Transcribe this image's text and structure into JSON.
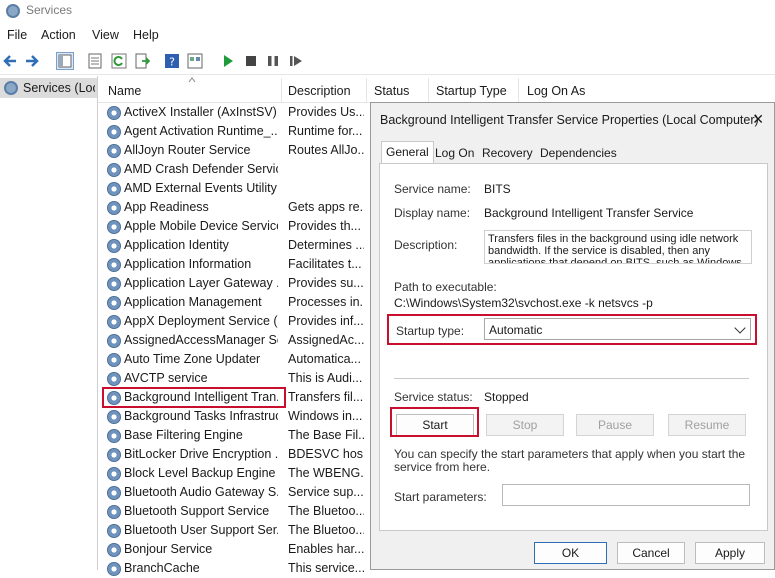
{
  "window": {
    "title": "Services"
  },
  "menu": [
    "File",
    "Action",
    "View",
    "Help"
  ],
  "left_pane": {
    "item": "Services (Local)"
  },
  "list": {
    "columns": [
      "Name",
      "Description",
      "Status",
      "Startup Type",
      "Log On As"
    ],
    "rows": [
      {
        "name": "ActiveX Installer (AxInstSV)",
        "desc": "Provides Us..."
      },
      {
        "name": "Agent Activation Runtime_...",
        "desc": "Runtime for..."
      },
      {
        "name": "AllJoyn Router Service",
        "desc": "Routes AllJo..."
      },
      {
        "name": "AMD Crash Defender Service",
        "desc": ""
      },
      {
        "name": "AMD External Events Utility",
        "desc": ""
      },
      {
        "name": "App Readiness",
        "desc": "Gets apps re..."
      },
      {
        "name": "Apple Mobile Device Service",
        "desc": "Provides th..."
      },
      {
        "name": "Application Identity",
        "desc": "Determines ..."
      },
      {
        "name": "Application Information",
        "desc": "Facilitates t..."
      },
      {
        "name": "Application Layer Gateway ...",
        "desc": "Provides su..."
      },
      {
        "name": "Application Management",
        "desc": "Processes in..."
      },
      {
        "name": "AppX Deployment Service (...",
        "desc": "Provides inf..."
      },
      {
        "name": "AssignedAccessManager Se...",
        "desc": "AssignedAc..."
      },
      {
        "name": "Auto Time Zone Updater",
        "desc": "Automatica..."
      },
      {
        "name": "AVCTP service",
        "desc": "This is Audi..."
      },
      {
        "name": "Background Intelligent Tran...",
        "desc": "Transfers fil..."
      },
      {
        "name": "Background Tasks Infrastruc...",
        "desc": "Windows in..."
      },
      {
        "name": "Base Filtering Engine",
        "desc": "The Base Fil..."
      },
      {
        "name": "BitLocker Drive Encryption ...",
        "desc": "BDESVC hos..."
      },
      {
        "name": "Block Level Backup Engine ...",
        "desc": "The WBENG..."
      },
      {
        "name": "Bluetooth Audio Gateway S...",
        "desc": "Service sup..."
      },
      {
        "name": "Bluetooth Support Service",
        "desc": "The Bluetoo..."
      },
      {
        "name": "Bluetooth User Support Ser...",
        "desc": "The Bluetoo..."
      },
      {
        "name": "Bonjour Service",
        "desc": "Enables har..."
      },
      {
        "name": "BranchCache",
        "desc": "This service..."
      }
    ]
  },
  "dialog": {
    "title": "Background Intelligent Transfer Service Properties (Local Computer)",
    "close": "✕",
    "tabs": [
      "General",
      "Log On",
      "Recovery",
      "Dependencies"
    ],
    "service_name_label": "Service name:",
    "service_name": "BITS",
    "display_name_label": "Display name:",
    "display_name": "Background Intelligent Transfer Service",
    "description_label": "Description:",
    "description": "Transfers files in the background using idle network bandwidth. If the service is disabled, then any applications that depend on BITS, such as Windows",
    "path_label": "Path to executable:",
    "path": "C:\\Windows\\System32\\svchost.exe -k netsvcs -p",
    "startup_type_label": "Startup type:",
    "startup_type": "Automatic",
    "service_status_label": "Service status:",
    "service_status": "Stopped",
    "buttons": {
      "start": "Start",
      "stop": "Stop",
      "pause": "Pause",
      "resume": "Resume"
    },
    "start_params_hint": "You can specify the start parameters that apply when you start the service from here.",
    "start_params_label": "Start parameters:",
    "start_params_value": "",
    "footer": {
      "ok": "OK",
      "cancel": "Cancel",
      "apply": "Apply"
    }
  },
  "colors": {
    "highlight": "#c8102e",
    "dialog_bg": "#f0f0f0"
  }
}
